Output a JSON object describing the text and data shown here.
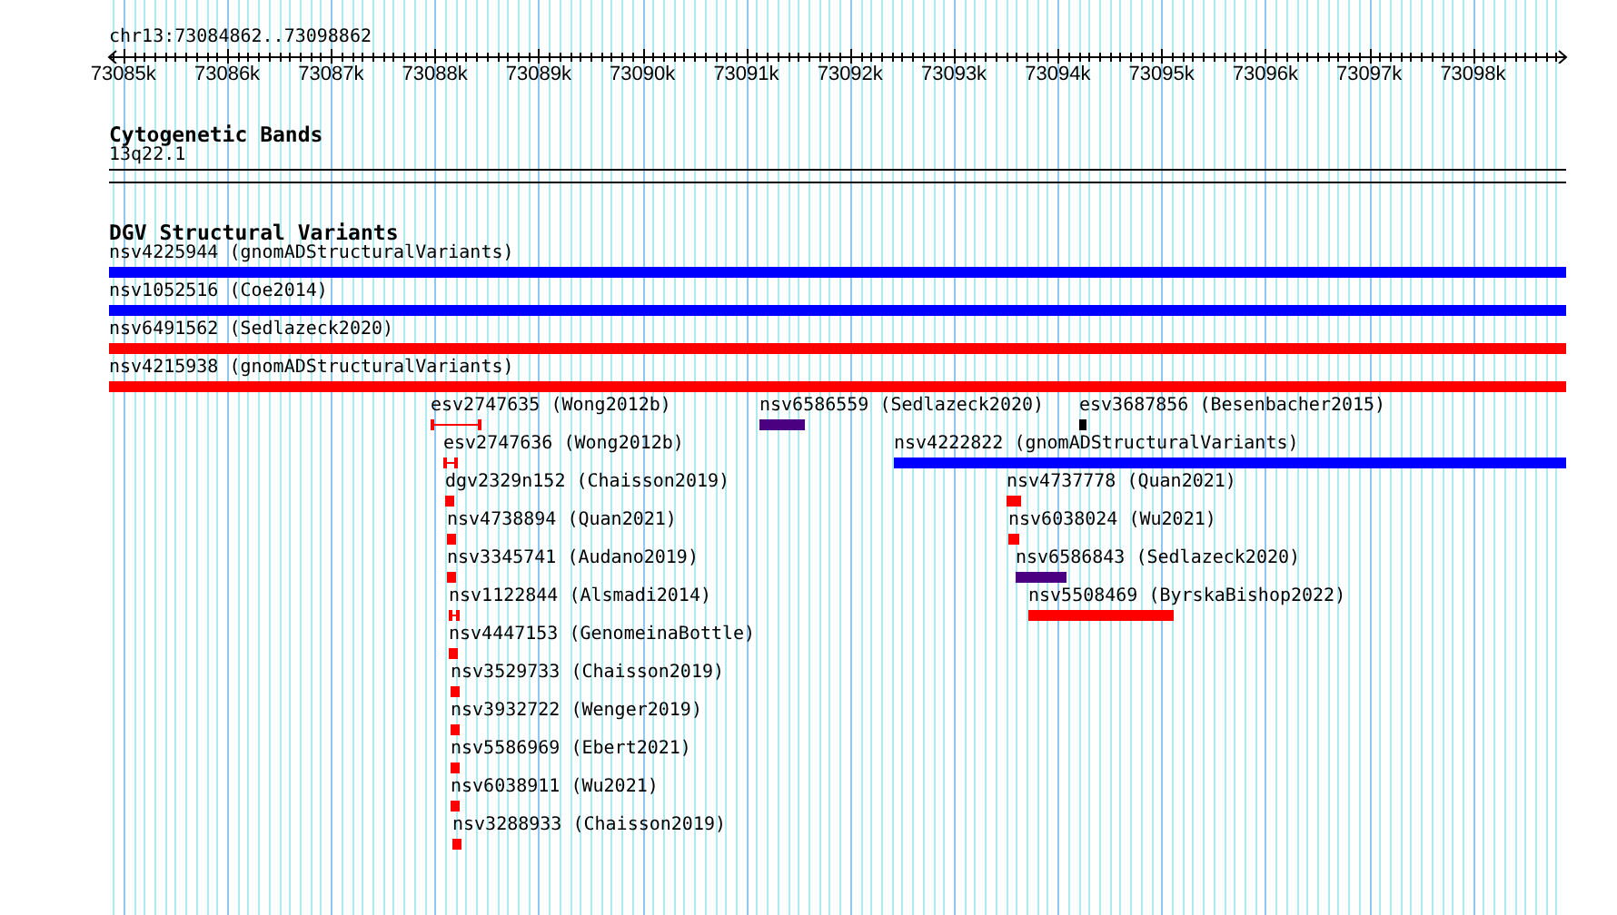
{
  "ruler": {
    "position": "chr13:73084862..73098862",
    "ticks": [
      "73085k",
      "73086k",
      "73087k",
      "73088k",
      "73089k",
      "73090k",
      "73091k",
      "73092k",
      "73093k",
      "73094k",
      "73095k",
      "73096k",
      "73097k",
      "73098k"
    ]
  },
  "cytogenetic_bands": {
    "title": "Cytogenetic Bands",
    "band": "13q22.1"
  },
  "dgv_track": {
    "title": "DGV Structural Variants",
    "rows": [
      {
        "features": [
          {
            "label": "nsv4225944 (gnomADStructuralVariants)",
            "color": "#0000ff",
            "kind": "bar"
          }
        ]
      },
      {
        "features": [
          {
            "label": "nsv1052516 (Coe2014)",
            "color": "#0000ff",
            "kind": "bar"
          }
        ]
      },
      {
        "features": [
          {
            "label": "nsv6491562 (Sedlazeck2020)",
            "color": "#ff0000",
            "kind": "bar"
          }
        ]
      },
      {
        "features": [
          {
            "label": "nsv4215938 (gnomADStructuralVariants)",
            "color": "#ff0000",
            "kind": "bar"
          }
        ]
      },
      {
        "features": [
          {
            "label": "esv2747635 (Wong2012b)",
            "color": "#ff0000",
            "kind": "whisker"
          },
          {
            "label": "nsv6586559 (Sedlazeck2020)",
            "color": "#4b0082",
            "kind": "bar"
          },
          {
            "label": "esv3687856 (Besenbacher2015)",
            "color": "#000000",
            "kind": "bar"
          }
        ]
      },
      {
        "features": [
          {
            "label": "esv2747636 (Wong2012b)",
            "color": "#ff0000",
            "kind": "whisker"
          },
          {
            "label": "nsv4222822 (gnomADStructuralVariants)",
            "color": "#0000ff",
            "kind": "bar"
          }
        ]
      },
      {
        "features": [
          {
            "label": "dgv2329n152 (Chaisson2019)",
            "color": "#ff0000",
            "kind": "bar"
          },
          {
            "label": "nsv4737778 (Quan2021)",
            "color": "#ff0000",
            "kind": "bar"
          }
        ]
      },
      {
        "features": [
          {
            "label": "nsv4738894 (Quan2021)",
            "color": "#ff0000",
            "kind": "bar"
          },
          {
            "label": "nsv6038024 (Wu2021)",
            "color": "#ff0000",
            "kind": "bar"
          }
        ]
      },
      {
        "features": [
          {
            "label": "nsv3345741 (Audano2019)",
            "color": "#ff0000",
            "kind": "bar"
          },
          {
            "label": "nsv6586843 (Sedlazeck2020)",
            "color": "#4b0082",
            "kind": "bar"
          }
        ]
      },
      {
        "features": [
          {
            "label": "nsv1122844 (Alsmadi2014)",
            "color": "#ff0000",
            "kind": "whisker"
          },
          {
            "label": "nsv5508469 (ByrskaBishop2022)",
            "color": "#ff0000",
            "kind": "bar"
          }
        ]
      },
      {
        "features": [
          {
            "label": "nsv4447153 (GenomeinaBottle)",
            "color": "#ff0000",
            "kind": "bar"
          }
        ]
      },
      {
        "features": [
          {
            "label": "nsv3529733 (Chaisson2019)",
            "color": "#ff0000",
            "kind": "bar"
          }
        ]
      },
      {
        "features": [
          {
            "label": "nsv3932722 (Wenger2019)",
            "color": "#ff0000",
            "kind": "bar"
          }
        ]
      },
      {
        "features": [
          {
            "label": "nsv5586969 (Ebert2021)",
            "color": "#ff0000",
            "kind": "bar"
          }
        ]
      },
      {
        "features": [
          {
            "label": "nsv6038911 (Wu2021)",
            "color": "#ff0000",
            "kind": "bar"
          }
        ]
      },
      {
        "features": [
          {
            "label": "nsv3288933 (Chaisson2019)",
            "color": "#ff0000",
            "kind": "bar"
          }
        ]
      }
    ]
  }
}
